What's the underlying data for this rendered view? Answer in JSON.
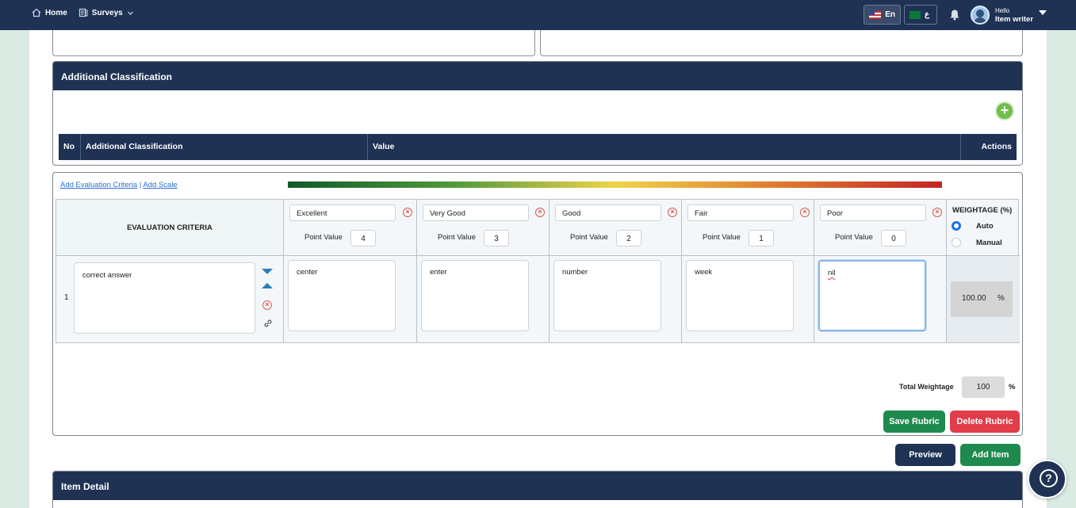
{
  "nav": {
    "home": "Home",
    "surveys": "Surveys"
  },
  "lang": {
    "en": "En",
    "ar": "ع"
  },
  "user": {
    "greeting": "Hello",
    "name": "Item writer"
  },
  "additional_classification": {
    "title": "Additional Classification",
    "columns": [
      "No",
      "Additional Classification",
      "Value",
      "Actions"
    ]
  },
  "rubric": {
    "add_criteria": "Add Evaluation Criteria",
    "separator": "|",
    "add_scale": "Add Scale",
    "criteria_header": "EVALUATION CRITERIA",
    "point_value_label": "Point Value",
    "scales": [
      {
        "name": "Excellent",
        "points": "4",
        "description": "center"
      },
      {
        "name": "Very Good",
        "points": "3",
        "description": "enter"
      },
      {
        "name": "Good",
        "points": "2",
        "description": "number"
      },
      {
        "name": "Fair",
        "points": "1",
        "description": "week"
      },
      {
        "name": "Poor",
        "points": "0",
        "description": "nil"
      }
    ],
    "weightage": {
      "title": "WEIGHTAGE (%)",
      "auto": "Auto",
      "manual": "Manual",
      "selected": "Auto"
    },
    "rows": [
      {
        "no": "1",
        "criteria": "correct answer",
        "weight": "100.00",
        "unit": "%"
      }
    ],
    "total_label": "Total Weightage",
    "total_value": "100",
    "total_unit": "%",
    "save": "Save Rubric",
    "delete": "Delete Rubric"
  },
  "actions": {
    "preview": "Preview",
    "add_item": "Add Item"
  },
  "item_detail": {
    "title": "Item Detail"
  },
  "colors": {
    "navy": "#1f3254",
    "green": "#1f8a4e",
    "red": "#e03c4a",
    "accent": "#6fbf4a"
  },
  "icons": [
    "home-icon",
    "surveys-icon",
    "chevron-down-icon",
    "bell-icon",
    "avatar",
    "add-icon",
    "remove-icon",
    "move-down-icon",
    "move-up-icon",
    "link-icon",
    "help-icon"
  ]
}
